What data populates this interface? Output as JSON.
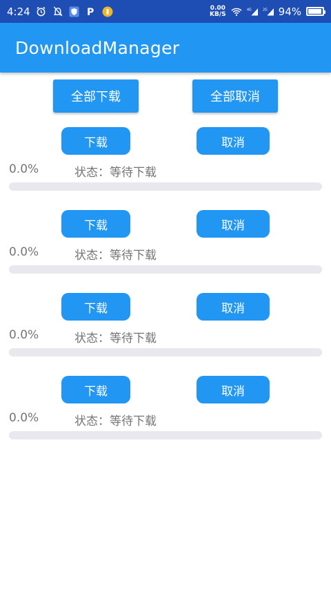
{
  "status_bar": {
    "time": "4:24",
    "net_speed_value": "0.00",
    "net_speed_unit": "KB/S",
    "battery_percent": "94%",
    "battery_level": 0.94
  },
  "app_bar": {
    "title": "DownloadManager"
  },
  "actions": {
    "download_all": "全部下载",
    "cancel_all": "全部取消"
  },
  "items": [
    {
      "download_label": "下载",
      "cancel_label": "取消",
      "percent": "0.0%",
      "status": "状态：等待下载",
      "progress": 0.0
    },
    {
      "download_label": "下载",
      "cancel_label": "取消",
      "percent": "0.0%",
      "status": "状态：等待下载",
      "progress": 0.0
    },
    {
      "download_label": "下载",
      "cancel_label": "取消",
      "percent": "0.0%",
      "status": "状态：等待下载",
      "progress": 0.0
    },
    {
      "download_label": "下载",
      "cancel_label": "取消",
      "percent": "0.0%",
      "status": "状态：等待下载",
      "progress": 0.0
    }
  ],
  "colors": {
    "status_bar": "#1e4db3",
    "primary": "#2196f3",
    "track": "#e8e8ee",
    "text_secondary": "#757575"
  }
}
